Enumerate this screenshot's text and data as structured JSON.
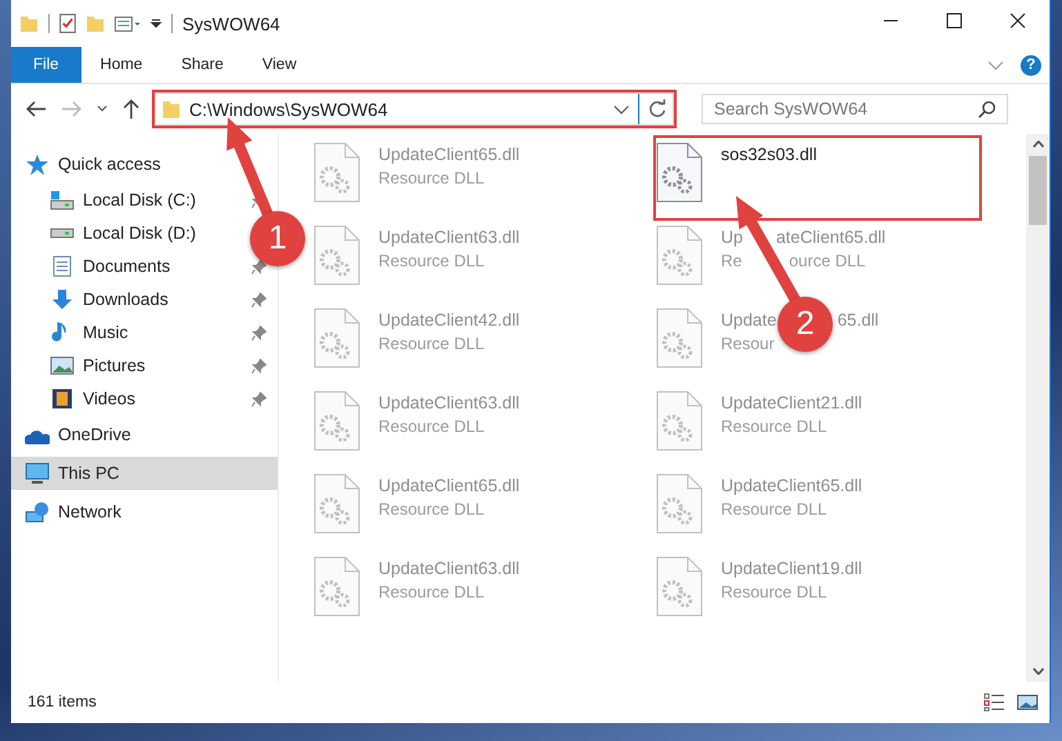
{
  "window": {
    "title": "SysWOW64"
  },
  "ribbon": {
    "tabs": [
      {
        "label": "File",
        "selected": true
      },
      {
        "label": "Home",
        "selected": false
      },
      {
        "label": "Share",
        "selected": false
      },
      {
        "label": "View",
        "selected": false
      }
    ],
    "help": "?"
  },
  "address": {
    "path": "C:\\Windows\\SysWOW64"
  },
  "search": {
    "placeholder": "Search SysWOW64"
  },
  "sidebar": {
    "items": [
      {
        "label": "Quick access",
        "kind": "star",
        "selected": false,
        "children": [
          {
            "label": "Local Disk (C:)",
            "kind": "drive-c",
            "selected": false,
            "pinned": true
          },
          {
            "label": "Local Disk (D:)",
            "kind": "drive",
            "selected": false,
            "pinned": false
          },
          {
            "label": "Documents",
            "kind": "documents",
            "selected": false,
            "pinned": true
          },
          {
            "label": "Downloads",
            "kind": "downloads",
            "selected": false,
            "pinned": true
          },
          {
            "label": "Music",
            "kind": "music",
            "selected": false,
            "pinned": true
          },
          {
            "label": "Pictures",
            "kind": "pictures",
            "selected": false,
            "pinned": true
          },
          {
            "label": "Videos",
            "kind": "videos",
            "selected": false,
            "pinned": true
          }
        ]
      },
      {
        "label": "OneDrive",
        "kind": "cloud",
        "selected": false
      },
      {
        "label": "This PC",
        "kind": "pc",
        "selected": true
      },
      {
        "label": "Network",
        "kind": "network",
        "selected": false
      }
    ]
  },
  "files": [
    {
      "name": "UpdateClient65.dll",
      "type": "Resource DLL",
      "faded": true
    },
    {
      "name": "sos32s03.dll",
      "faded": false
    },
    {
      "name": "UpdateClient63.dll",
      "type": "Resource DLL",
      "faded": true
    },
    {
      "name": "Up",
      "name_end": "ateClient65.dll",
      "type": "Re",
      "type_end": "ource DLL",
      "kind": "crossed",
      "faded": true
    },
    {
      "name": "UpdateClient42.dll",
      "type": "Resource DLL",
      "faded": true
    },
    {
      "name": "Update",
      "name_end": "65.dll",
      "type": "Resour",
      "kind": "covered",
      "faded": true
    },
    {
      "name": "UpdateClient63.dll",
      "type": "Resource DLL",
      "faded": true
    },
    {
      "name": "UpdateClient21.dll",
      "type": "Resource DLL",
      "faded": true
    },
    {
      "name": "UpdateClient65.dll",
      "type": "Resource DLL",
      "faded": true
    },
    {
      "name": "UpdateClient65.dll",
      "type": "Resource DLL",
      "faded": true
    },
    {
      "name": "UpdateClient63.dll",
      "type": "Resource DLL",
      "faded": true
    },
    {
      "name": "UpdateClient19.dll",
      "type": "Resource DLL",
      "faded": true
    }
  ],
  "status_bar": {
    "count": "161 items"
  },
  "annotations": [
    {
      "number": "1"
    },
    {
      "number": "2"
    }
  ]
}
